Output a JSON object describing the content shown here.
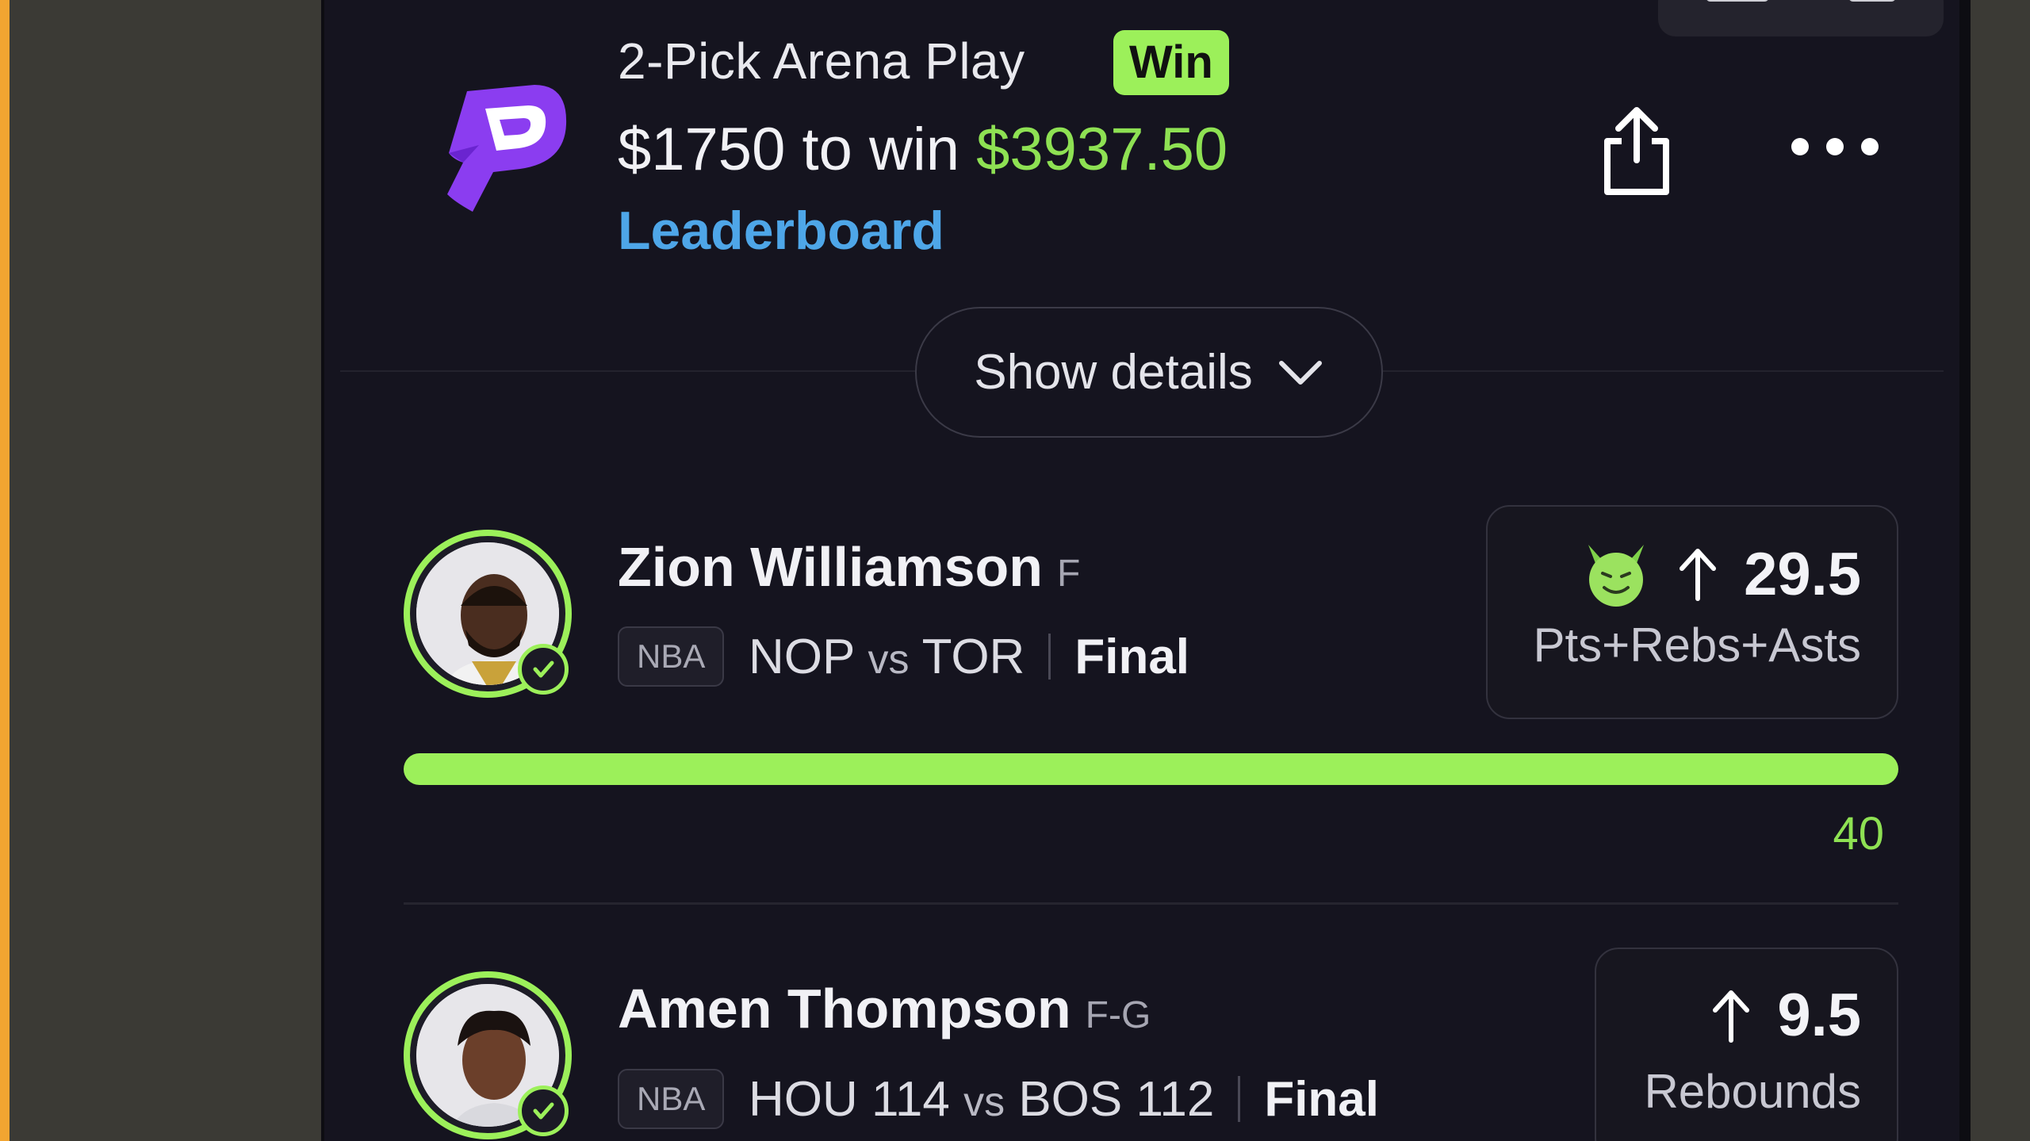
{
  "colors": {
    "background": "#3b3a35",
    "app_bg": "#15141f",
    "accent_green": "#9cf05a",
    "payout_green": "#8ee153",
    "link_blue": "#4ea6e8",
    "logo_purple": "#8b3df0"
  },
  "header": {
    "title": "2-Pick Arena Play",
    "badge": "Win",
    "wager_prefix": "$1750 to win",
    "payout": "$3937.50",
    "leaderboard_label": "Leaderboard",
    "share_icon": "share-icon",
    "more_icon": "more-icon"
  },
  "details_toggle": {
    "label": "Show details",
    "icon": "chevron-down-icon"
  },
  "picks": [
    {
      "name": "Zion Williamson",
      "position": "F",
      "league": "NBA",
      "team_a": "NOP",
      "vs": "vs",
      "team_b": "TOR",
      "status": "Final",
      "direction_icon": "arrow-up-icon",
      "modifier_icon": "devil-emoji-icon",
      "line": "29.5",
      "stat": "Pts+Rebs+Asts",
      "result": "40",
      "progress_fraction": 1.0
    },
    {
      "name": "Amen Thompson",
      "position": "F-G",
      "league": "NBA",
      "team_a": "HOU 114",
      "vs": "vs",
      "team_b": "BOS 112",
      "status": "Final",
      "direction_icon": "arrow-up-icon",
      "line": "9.5",
      "stat": "Rebounds"
    }
  ]
}
